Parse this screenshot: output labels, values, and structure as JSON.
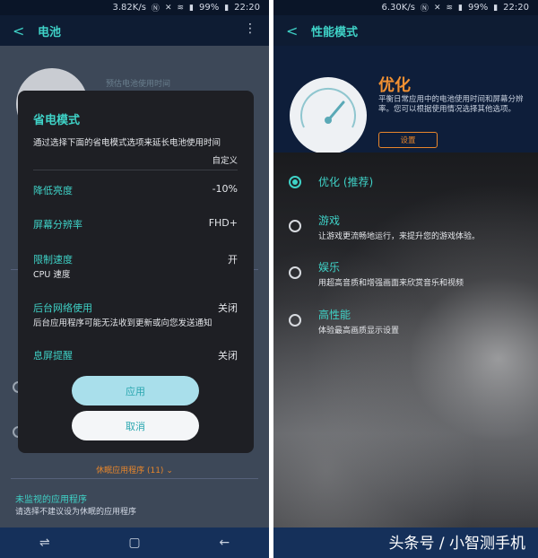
{
  "left": {
    "status": {
      "speed": "3.82K/s",
      "battery": "99%",
      "time": "22:20"
    },
    "appbar": {
      "title": "电池"
    },
    "background": {
      "estimate_label": "预估电池使用时间"
    },
    "dialog": {
      "title": "省电模式",
      "description": "通过选择下面的省电模式选项来延长电池使用时间",
      "custom_label": "自定义",
      "rows": [
        {
          "label": "降低亮度",
          "value": "-10%",
          "sub": ""
        },
        {
          "label": "屏幕分辨率",
          "value": "FHD+",
          "sub": ""
        },
        {
          "label": "限制速度",
          "value": "开",
          "sub": "CPU 速度"
        },
        {
          "label": "后台网络使用",
          "value": "关闭",
          "sub": "后台应用程序可能无法收到更新或向您发送通知"
        },
        {
          "label": "息屏提醒",
          "value": "关闭",
          "sub": ""
        }
      ],
      "apply_label": "应用",
      "cancel_label": "取消"
    },
    "below": {
      "sleeping_apps": "休眠应用程序 (11)",
      "unmonitored_title": "未监视的应用程序",
      "unmonitored_desc": "请选择不建议设为休眠的应用程序"
    }
  },
  "right": {
    "status": {
      "speed": "6.30K/s",
      "battery": "99%",
      "time": "22:20"
    },
    "appbar": {
      "title": "性能模式"
    },
    "header": {
      "mode_title": "优化",
      "mode_desc": "平衡日常应用中的电池使用时间和屏幕分辨率。您可以根据使用情况选择其他选项。",
      "settings_label": "设置"
    },
    "options": [
      {
        "label": "优化 (推荐)",
        "sub": "",
        "selected": true
      },
      {
        "label": "游戏",
        "sub": "让游戏更流畅地运行，来提升您的游戏体验。",
        "selected": false
      },
      {
        "label": "娱乐",
        "sub": "用超高音质和增强画面来欣赏音乐和视频",
        "selected": false
      },
      {
        "label": "高性能",
        "sub": "体验最高画质显示设置",
        "selected": false
      }
    ],
    "watermark": "头条号 / 小智测手机"
  },
  "colors": {
    "accent": "#3fd2c7",
    "orange": "#e8862b",
    "dialog_bg": "#1e1f24"
  }
}
